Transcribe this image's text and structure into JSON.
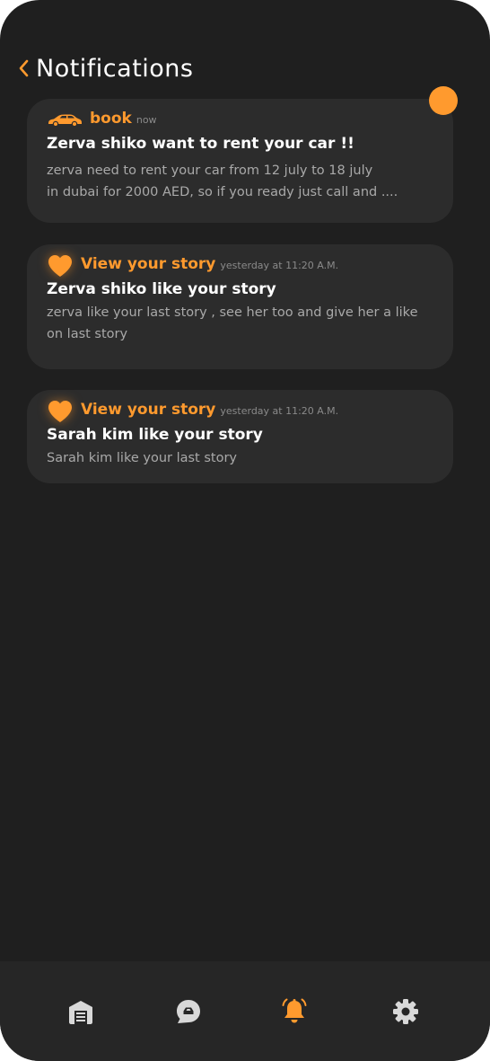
{
  "header": {
    "title": "Notifications",
    "back_icon": "chevron-left-icon"
  },
  "colors": {
    "background": "#1f1f1f",
    "card": "#2c2c2c",
    "accent": "#ff9a2e",
    "nav_background": "#262626",
    "nav_icon_inactive": "#d8d8d8"
  },
  "notifications": [
    {
      "icon": "car-icon",
      "kind": "book",
      "time": "now",
      "title": "Zerva shiko want to rent your car !!",
      "body_lines": [
        "zerva need to rent your car from 12 july to 18 july",
        "in dubai for 2000 AED, so if you ready just call and ...."
      ],
      "unread": true
    },
    {
      "icon": "heart-icon",
      "kind": "View your story",
      "time": "yesterday at 11:20 A.M.",
      "title": "Zerva shiko like your story",
      "body_lines": [
        "zerva like your last story , see her too and give her a like",
        "on last story"
      ]
    },
    {
      "icon": "heart-icon",
      "kind": "View your story",
      "time": "yesterday at 11:20 A.M.",
      "title": "Sarah kim like your story",
      "body_lines": [
        "Sarah kim like your last story"
      ]
    }
  ],
  "bottom_nav": {
    "items": [
      {
        "icon": "garage-icon",
        "active": false
      },
      {
        "icon": "chat-icon",
        "active": false
      },
      {
        "icon": "bell-icon",
        "active": true
      },
      {
        "icon": "gear-icon",
        "active": false
      }
    ]
  }
}
